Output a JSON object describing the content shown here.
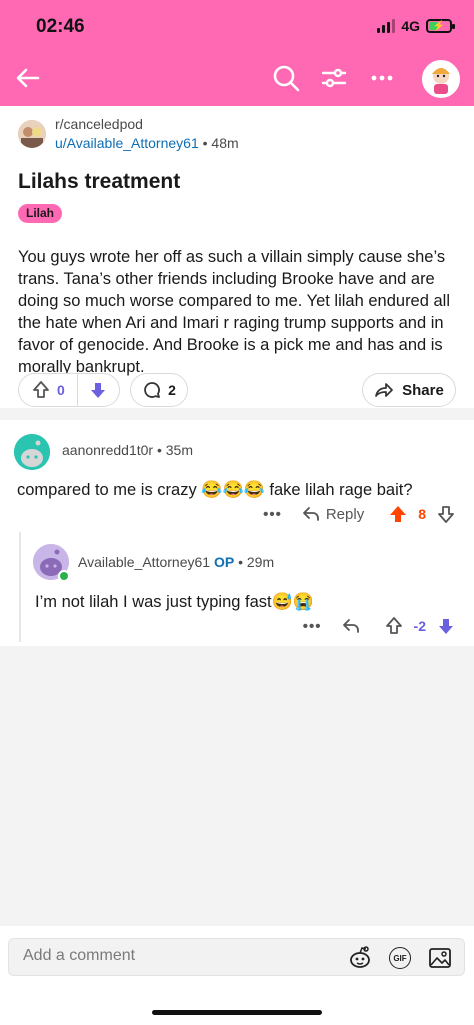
{
  "status_bar": {
    "time": "02:46",
    "network": "4G"
  },
  "nav": {
    "back_icon": "arrow-left-icon",
    "icons": [
      "search-icon",
      "filter-icon",
      "more-icon"
    ],
    "avatar": "user-avatar"
  },
  "post": {
    "subreddit": "r/canceledpod",
    "author": "u/Available_Attorney61",
    "age": "• 48m",
    "title": "Lilahs treatment",
    "flair": "Lilah",
    "body": "You guys wrote her off as such a villain simply cause she’s trans. Tana’s other friends including Brooke have and are doing so much worse compared to me. Yet lilah endured all the hate when Ari and Imari r raging trump supports and in favor of genocide. And Brooke is a pick me and has and is morally bankrupt.",
    "score": "0",
    "comment_count": "2",
    "share_label": "Share"
  },
  "comments": [
    {
      "user": "aanonredd1t0r",
      "age": "• 35m",
      "text": "compared to me is crazy ",
      "emoji": "😂😂😂",
      "text_after": " fake lilah rage bait?",
      "reply_label": "Reply",
      "score": "8",
      "more": "•••"
    },
    {
      "user": "Available_Attorney61",
      "op_label": "OP",
      "age": "• 29m",
      "text": "I’m not lilah I was just typing fast",
      "emoji": "😅😭",
      "score": "-2",
      "more": "•••"
    }
  ],
  "composer": {
    "placeholder": "Add a comment",
    "icons": [
      "snoo-icon",
      "gif-icon",
      "image-icon"
    ]
  },
  "colors": {
    "header": "#ff69b4",
    "upvote_active": "#ff4500",
    "downvote": "#6b60e0",
    "link": "#0f6fb5"
  }
}
